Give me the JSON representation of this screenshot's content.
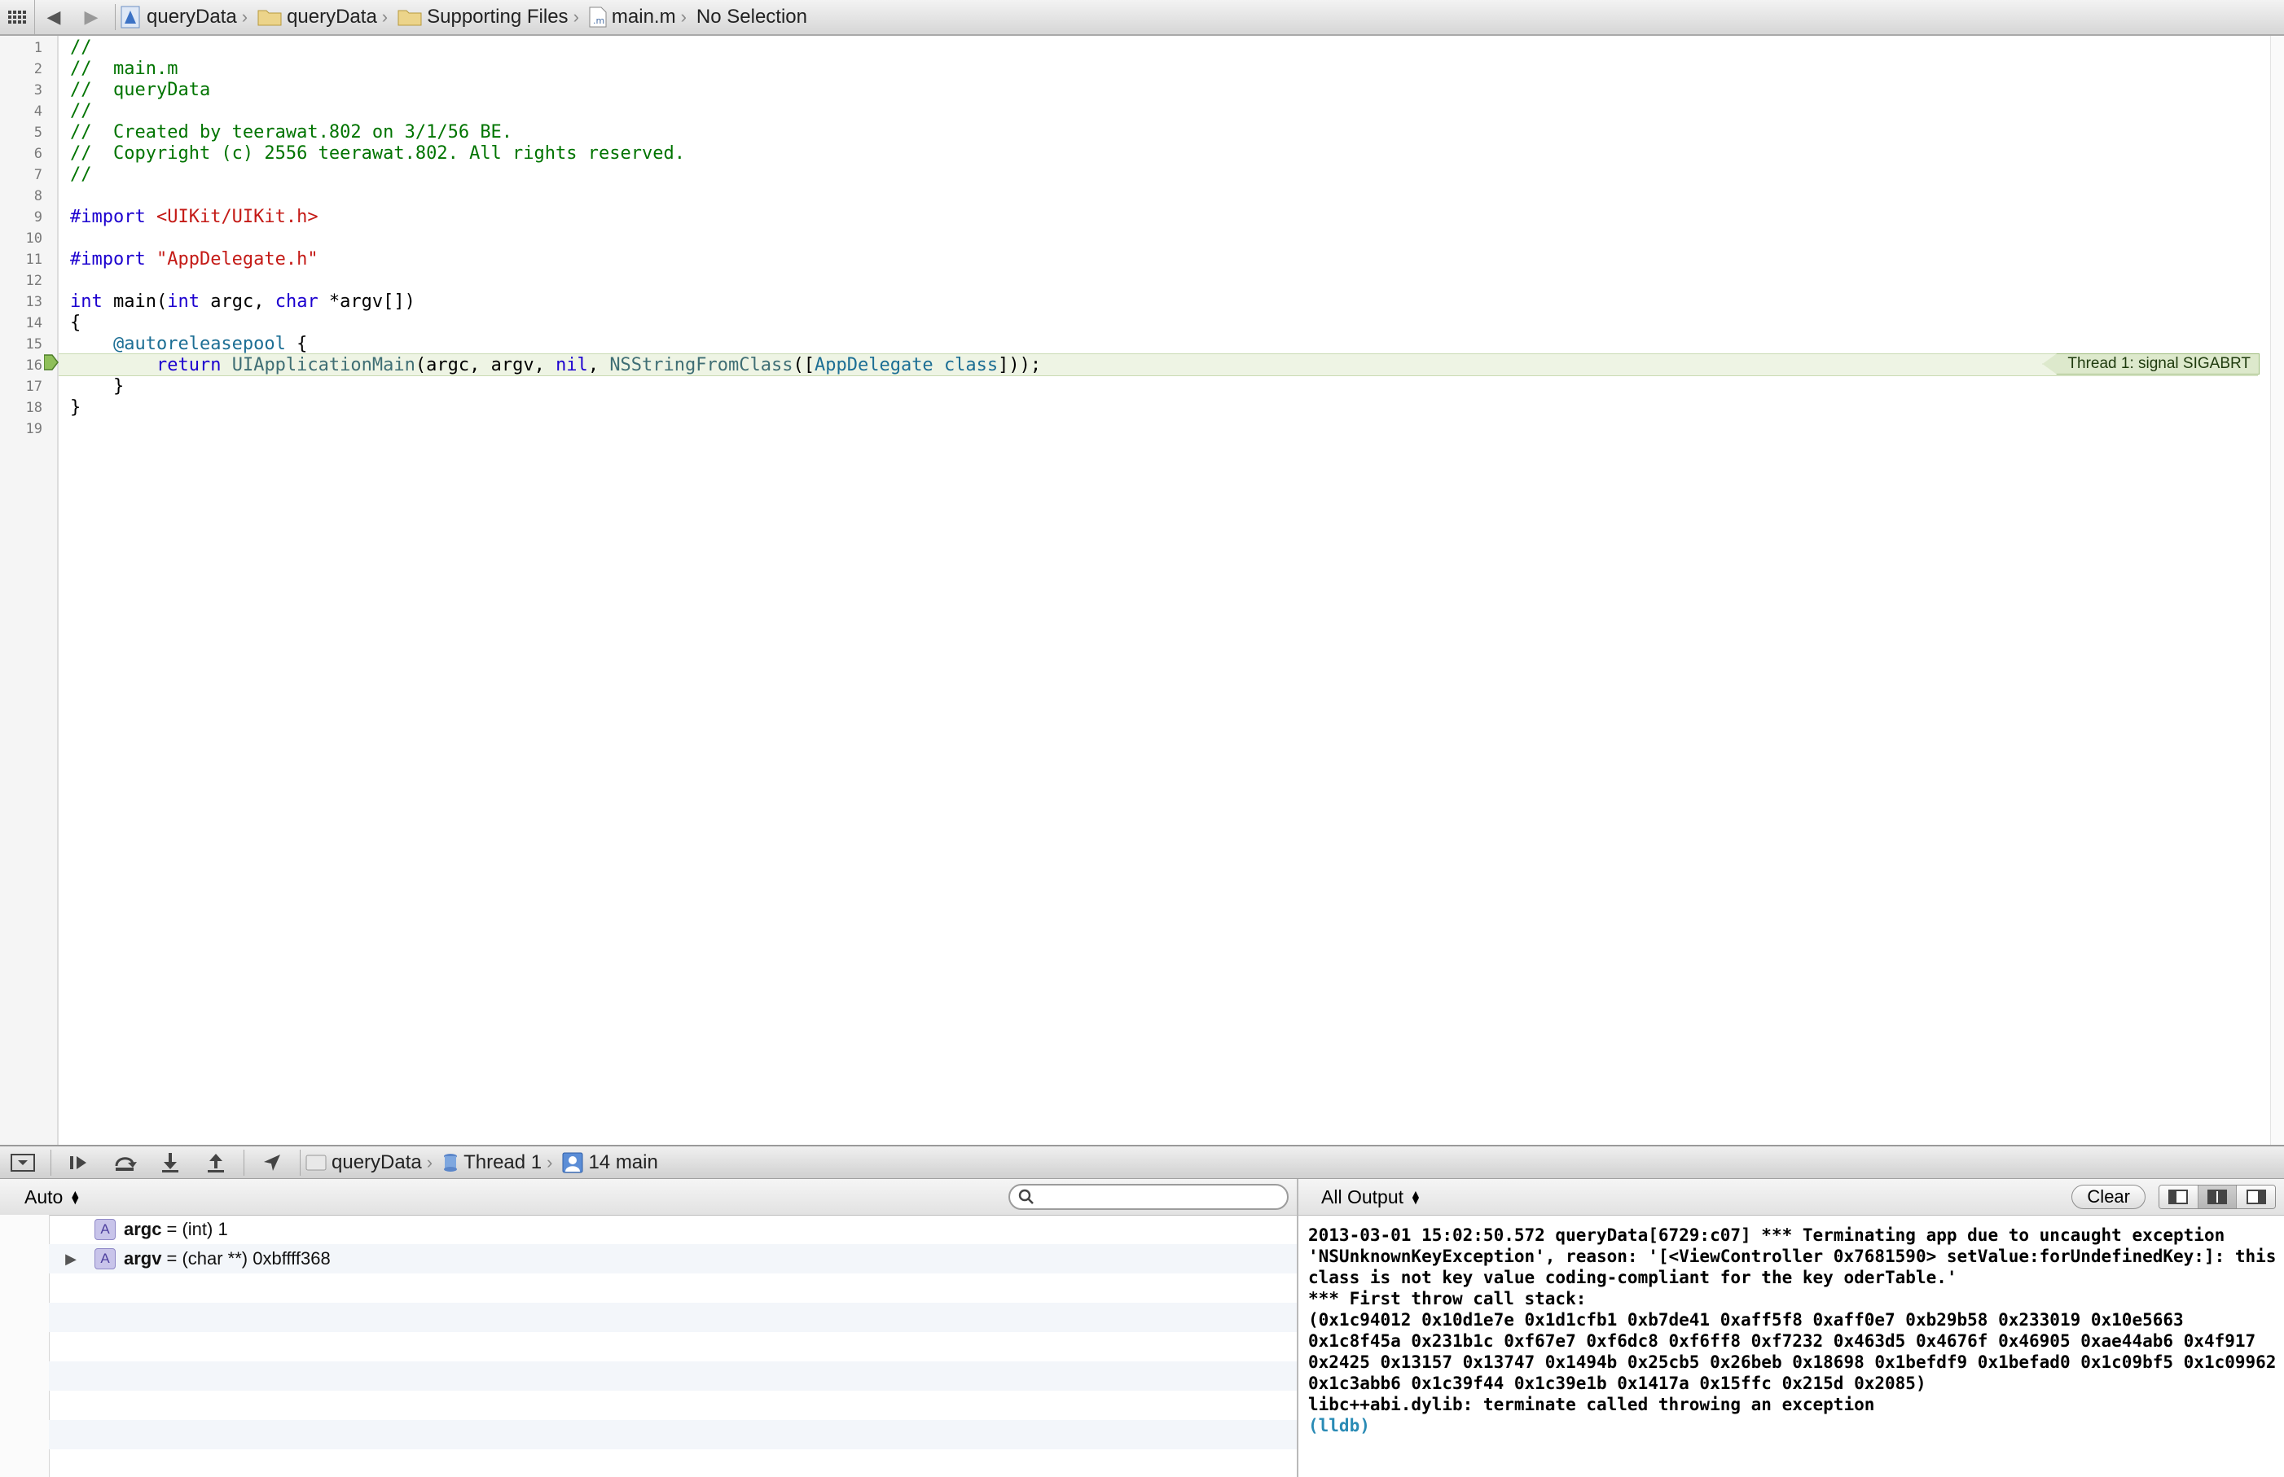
{
  "jumpbar": {
    "crumbs": [
      {
        "label": "queryData",
        "icon": "project-icon"
      },
      {
        "label": "queryData",
        "icon": "folder-icon"
      },
      {
        "label": "Supporting Files",
        "icon": "folder-icon"
      },
      {
        "label": "main.m",
        "icon": "m-file-icon"
      },
      {
        "label": "No Selection",
        "icon": ""
      }
    ]
  },
  "editor": {
    "line_numbers": [
      "1",
      "2",
      "3",
      "4",
      "5",
      "6",
      "7",
      "8",
      "9",
      "10",
      "11",
      "12",
      "13",
      "14",
      "15",
      "16",
      "17",
      "18",
      "19"
    ],
    "lines": [
      "//",
      "//  main.m",
      "//  queryData",
      "//",
      "//  Created by teerawat.802 on 3/1/56 BE.",
      "//  Copyright (c) 2556 teerawat.802. All rights reserved.",
      "//",
      "",
      "#import <UIKit/UIKit.h>",
      "",
      "#import \"AppDelegate.h\"",
      "",
      "int main(int argc, char *argv[])",
      "{",
      "    @autoreleasepool {",
      "        return UIApplicationMain(argc, argv, nil, NSStringFromClass([AppDelegate class]));",
      "    }",
      "}",
      ""
    ],
    "current_line": 16,
    "thread_badge": "Thread 1: signal SIGABRT"
  },
  "debugbar": {
    "crumbs": [
      "queryData",
      "Thread 1",
      "14 main"
    ]
  },
  "variables": {
    "scope": "Auto",
    "search_placeholder": "",
    "rows": [
      {
        "badge": "A",
        "name": "argc",
        "value": " = (int) 1",
        "expandable": false
      },
      {
        "badge": "A",
        "name": "argv",
        "value": " = (char **) 0xbffff368",
        "expandable": true
      }
    ]
  },
  "console": {
    "filter": "All Output",
    "clear_label": "Clear",
    "text": "2013-03-01 15:02:50.572 queryData[6729:c07] *** Terminating app due to uncaught exception 'NSUnknownKeyException', reason: '[<ViewController 0x7681590> setValue:forUndefinedKey:]: this class is not key value coding-compliant for the key oderTable.'\n*** First throw call stack:\n(0x1c94012 0x10d1e7e 0x1d1cfb1 0xb7de41 0xaff5f8 0xaff0e7 0xb29b58 0x233019 0x10e5663 0x1c8f45a 0x231b1c 0xf67e7 0xf6dc8 0xf6ff8 0xf7232 0x463d5 0x4676f 0x46905 0xae44ab6 0x4f917 0x2425 0x13157 0x13747 0x1494b 0x25cb5 0x26beb 0x18698 0x1befdf9 0x1befad0 0x1c09bf5 0x1c09962 0x1c3abb6 0x1c39f44 0x1c39e1b 0x1417a 0x15ffc 0x215d 0x2085)\nlibc++abi.dylib: terminate called throwing an exception",
    "prompt": "(lldb)"
  }
}
